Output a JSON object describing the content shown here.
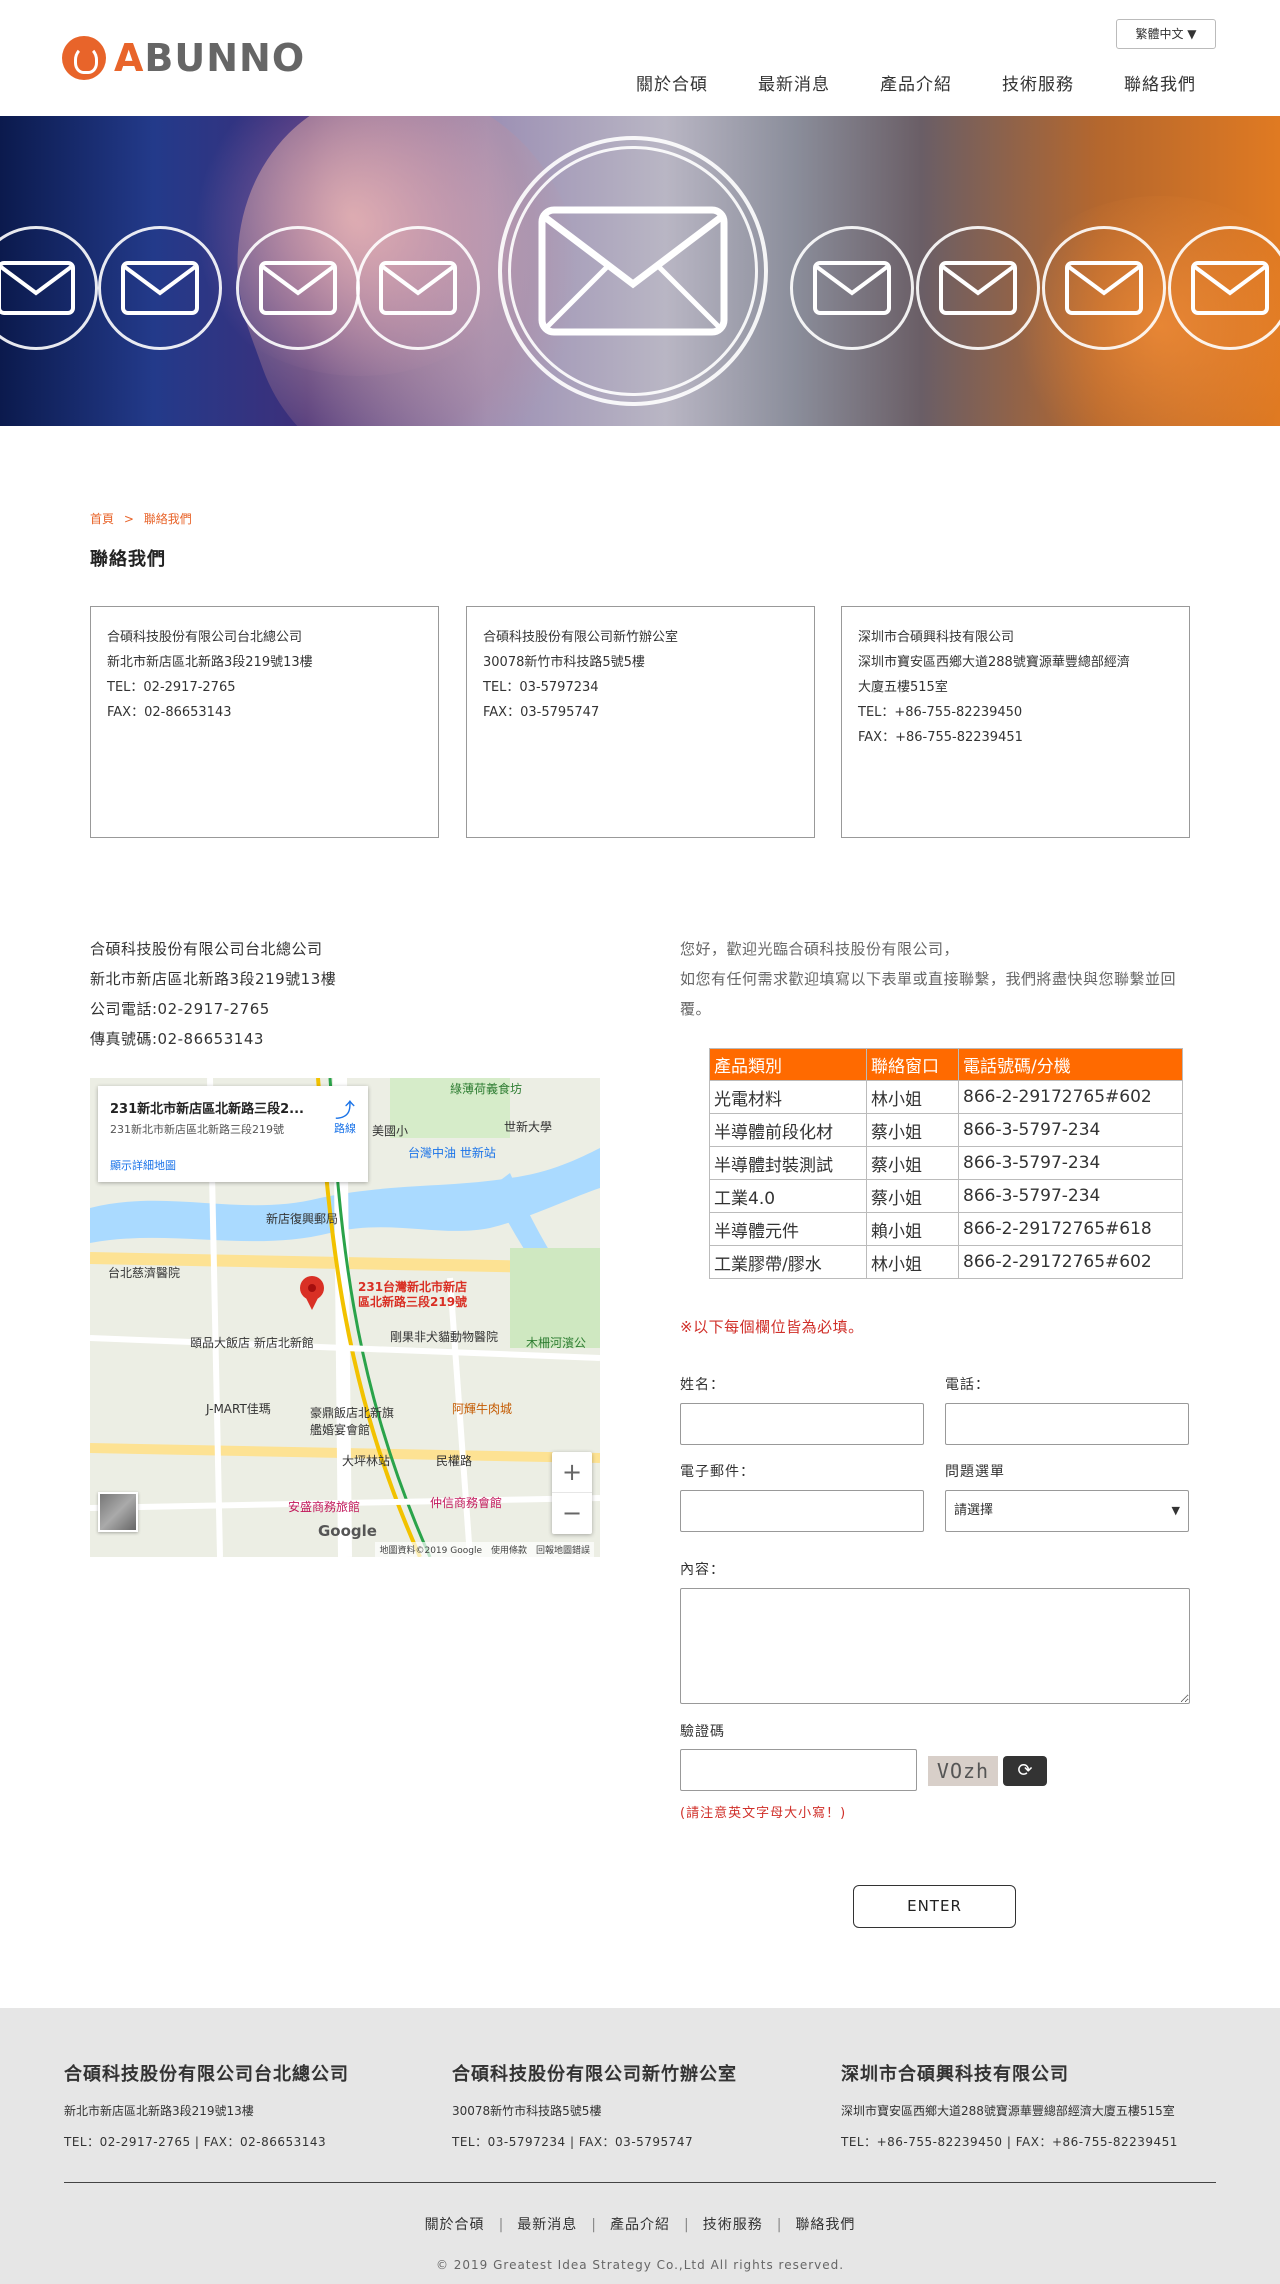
{
  "header": {
    "logo_text_accent": "A",
    "logo_text_rest": "BUNNO",
    "language": "繁體中文 ▼",
    "nav": [
      "關於合碩",
      "最新消息",
      "產品介紹",
      "技術服務",
      "聯絡我們"
    ]
  },
  "breadcrumb": {
    "home": "首頁",
    "sep": ">",
    "current": "聯絡我們"
  },
  "page_title": "聯絡我們",
  "offices": [
    {
      "lines": [
        "合碩科技股份有限公司台北總公司",
        "新北市新店區北新路3段219號13樓",
        "TEL：02-2917-2765",
        "FAX：02-86653143"
      ]
    },
    {
      "lines": [
        "合碩科技股份有限公司新竹辦公室",
        "30078新竹市科技路5號5樓",
        "TEL：03-5797234",
        "FAX：03-5795747"
      ]
    },
    {
      "lines": [
        "深圳市合碩興科技有限公司",
        "深圳市寶安區西鄉大道288號寶源華豐總部經濟",
        "大廈五樓515室",
        "TEL：+86-755-82239450",
        "FAX：+86-755-82239451"
      ]
    }
  ],
  "left_info": [
    "合碩科技股份有限公司台北總公司",
    "新北市新店區北新路3段219號13樓",
    "公司電話:02-2917-2765",
    "傳真號碼:02-86653143"
  ],
  "map": {
    "card_title": "231新北市新店區北新路三段2...",
    "card_address": "231新北市新店區北新路三段219號",
    "card_link": "顯示詳細地圖",
    "route_label": "路線",
    "pin_label_1": "231台灣新北市新店",
    "pin_label_2": "區北新路三段219號",
    "google": "Google",
    "attribution": "地圖資料©2019 Google　使用條款　回報地圖錯誤",
    "place_labels": [
      "綠薄荷義食坊",
      "美國小",
      "世新大學",
      "台灣中油 世新站",
      "新店復興郵局",
      "台北慈濟醫院",
      "頤品大飯店 新店北新館",
      "剛果非犬貓動物醫院",
      "J-MART佳瑪",
      "豪鼎飯店北新旗艦婚宴會館",
      "阿輝牛肉城",
      "大坪林站",
      "民權路",
      "安盛商務旅館",
      "仲信商務會館",
      "木柵河濱公"
    ]
  },
  "welcome": [
    "您好，歡迎光臨合碩科技股份有限公司，",
    "如您有任何需求歡迎填寫以下表單或直接聯繫，我們將盡快與您聯繫並回覆。"
  ],
  "contact_table": {
    "headers": [
      "產品類別",
      "聯絡窗口",
      "電話號碼/分機"
    ],
    "rows": [
      [
        "光電材料",
        "林小姐",
        "866-2-29172765#602"
      ],
      [
        "半導體前段化材",
        "蔡小姐",
        "866-3-5797-234"
      ],
      [
        "半導體封裝測試",
        "蔡小姐",
        "866-3-5797-234"
      ],
      [
        "工業4.0",
        "蔡小姐",
        "866-3-5797-234"
      ],
      [
        "半導體元件",
        "賴小姐",
        "866-2-29172765#618"
      ],
      [
        "工業膠帶/膠水",
        "林小姐",
        "866-2-29172765#602"
      ]
    ],
    "header_color": "#ff6a00"
  },
  "form": {
    "required_note": "※以下每個欄位皆為必填。",
    "name_label": "姓名：",
    "phone_label": "電話：",
    "email_label": "電子郵件：",
    "question_label": "問題選單",
    "question_value": "請選擇",
    "content_label": "內容：",
    "captcha_label": "驗證碼",
    "captcha_text": "VOzh",
    "captcha_note": "(請注意英文字母大小寫！)",
    "submit": "ENTER"
  },
  "footer": {
    "cols": [
      {
        "name": "合碩科技股份有限公司台北總公司",
        "addr": "新北市新店區北新路3段219號13樓",
        "tel": "TEL：02-2917-2765 | FAX：02-86653143"
      },
      {
        "name": "合碩科技股份有限公司新竹辦公室",
        "addr": "30078新竹市科技路5號5樓",
        "tel": "TEL：03-5797234 | FAX：03-5795747"
      },
      {
        "name": "深圳市合碩興科技有限公司",
        "addr": "深圳市寶安區西鄉大道288號寶源華豐總部經濟大廈五樓515室",
        "tel": "TEL：+86-755-82239450 | FAX：+86-755-82239451"
      }
    ],
    "nav": [
      "關於合碩",
      "最新消息",
      "產品介紹",
      "技術服務",
      "聯絡我們"
    ],
    "copyright": "© 2019 Greatest Idea Strategy Co.,Ltd All rights reserved."
  },
  "colors": {
    "accent": "#e8642a",
    "table_header": "#ff6a00",
    "required": "#d0302a"
  }
}
